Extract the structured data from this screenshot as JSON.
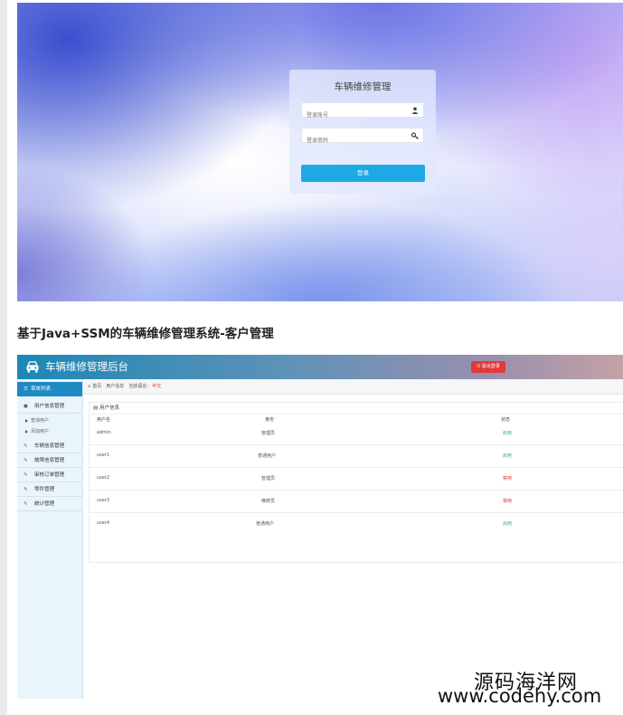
{
  "login": {
    "title": "车辆维修管理",
    "username_placeholder": "登录账号",
    "password_placeholder": "登录密码",
    "login_button": "登录"
  },
  "heading": "基于Java+SSM的车辆维修管理系统-客户管理",
  "admin": {
    "title": "车辆维修管理后台",
    "logout_label": "退出登录",
    "menu_title": "菜单列表",
    "menu": [
      {
        "label": "用户信息管理",
        "icon": "user-icon"
      },
      {
        "label": "车辆信息管理",
        "icon": "edit-icon"
      },
      {
        "label": "故障信息管理",
        "icon": "edit-icon"
      },
      {
        "label": "审核订单管理",
        "icon": "edit-icon"
      },
      {
        "label": "零件管理",
        "icon": "edit-icon"
      },
      {
        "label": "统计管理",
        "icon": "edit-icon"
      }
    ],
    "submenu": [
      "查询用户",
      "添加用户"
    ],
    "breadcrumb": {
      "home": "首页",
      "current": "用户信息",
      "lang_label": "当前语言：",
      "lang_value": "中文"
    },
    "panel_title": "用户信息",
    "columns": [
      "用户名",
      "身份",
      "状态"
    ],
    "rows": [
      {
        "username": "admin",
        "role": "管理员",
        "status": "启用",
        "status_color": "#2dbb7a"
      },
      {
        "username": "user1",
        "role": "普通用户",
        "status": "启用",
        "status_color": "#2dbb7a"
      },
      {
        "username": "user2",
        "role": "管理员",
        "status": "禁用",
        "status_color": "#e53b3b"
      },
      {
        "username": "user3",
        "role": "维修员",
        "status": "禁用",
        "status_color": "#e53b3b"
      },
      {
        "username": "user4",
        "role": "普通用户",
        "status": "启用",
        "status_color": "#2dbb7a"
      }
    ]
  },
  "watermark": {
    "name": "源码海洋网",
    "url": "www.codehy.com"
  },
  "colors": {
    "accent": "#1da9e6",
    "sidebar_header": "#1e8ac4",
    "logout": "#e13a3a"
  }
}
